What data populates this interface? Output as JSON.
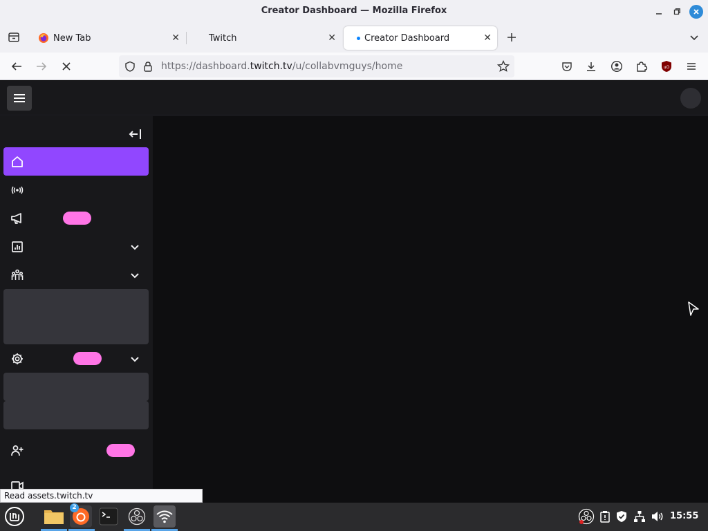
{
  "window": {
    "title": "Creator Dashboard — Mozilla Firefox"
  },
  "tabs": [
    {
      "label": "New Tab",
      "active": false
    },
    {
      "label": "Twitch",
      "active": false
    },
    {
      "label": "Creator Dashboard",
      "active": true
    }
  ],
  "navbar": {
    "url_prefix": "https://dashboard.",
    "url_domain": "twitch.tv",
    "url_path": "/u/collabvmguys/home"
  },
  "status": {
    "text": "Read assets.twitch.tv"
  },
  "sidebar": {
    "items": [
      {
        "icon": "home-icon",
        "active": true
      },
      {
        "icon": "broadcast-icon",
        "active": false
      },
      {
        "icon": "megaphone-icon",
        "active": false
      },
      {
        "icon": "analytics-icon",
        "active": false,
        "expandable": true
      },
      {
        "icon": "community-icon",
        "active": false,
        "expandable": true
      },
      {
        "icon": "settings-icon",
        "active": false,
        "expandable": true
      },
      {
        "icon": "add-user-icon",
        "active": false
      },
      {
        "icon": "video-icon",
        "active": false
      }
    ]
  },
  "taskbar": {
    "firefox_badge": "2",
    "clock": "15:55"
  },
  "colors": {
    "twitch_purple": "#9147ff",
    "pill_pink": "#ff75e6",
    "page_bg": "#0e0e10",
    "sidebar_bg": "#18181b"
  }
}
